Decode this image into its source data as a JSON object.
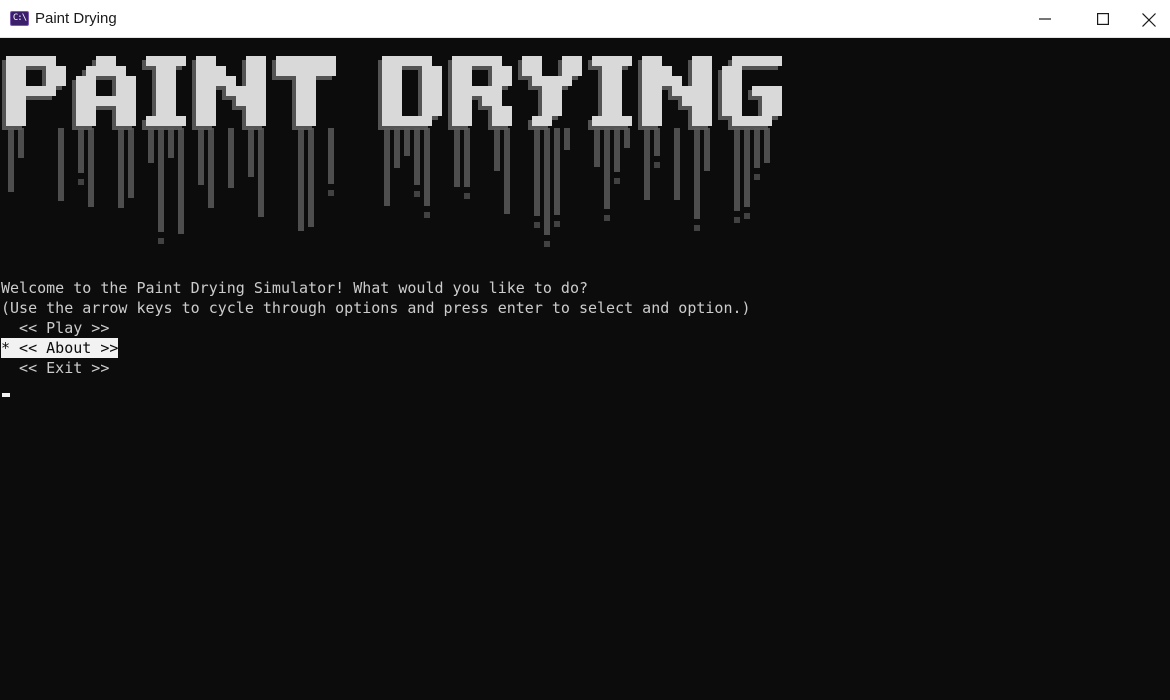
{
  "window": {
    "title": "Paint Drying",
    "icon": "terminal-icon",
    "icon_glyph": "C:\\"
  },
  "title_controls": {
    "minimize_icon": "minimize-icon",
    "maximize_icon": "maximize-icon",
    "close_icon": "close-icon"
  },
  "banner": {
    "text": "PAINT DRYING",
    "style": "ascii-art dripping block letters",
    "colors": {
      "solid": "#d9d9d9",
      "shade": "#8f8f8f",
      "dim": "#5a5a5a"
    }
  },
  "console": {
    "welcome": "Welcome to the Paint Drying Simulator! What would you like to do?",
    "instructions": "(Use the arrow keys to cycle through options and press enter to select and option.)",
    "options": [
      {
        "label": "  << Play >>",
        "selected": false
      },
      {
        "label": "* << About >>",
        "selected": true
      },
      {
        "label": "  << Exit >>",
        "selected": false
      }
    ],
    "cursor": "blinking-cursor"
  },
  "colors": {
    "console_bg": "#0c0c0c",
    "console_text": "#cccccc",
    "highlight_bg": "#f2f2f2",
    "titlebar_bg": "#ffffff"
  }
}
